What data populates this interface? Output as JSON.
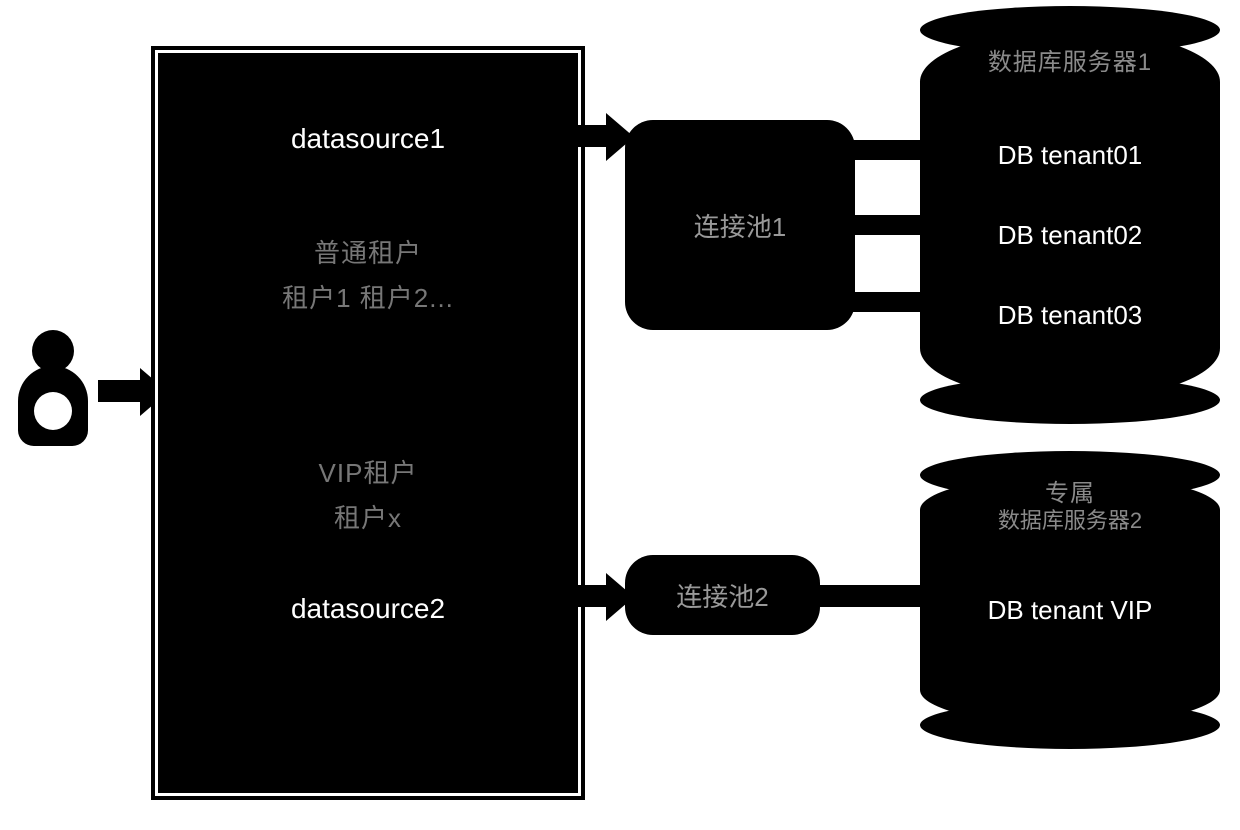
{
  "user_icon": "person-icon",
  "mainbox": {
    "datasource1_label": "datasource1",
    "users_group1_line1": "普通租户",
    "users_group1_line2": "租户1   租户2...",
    "users_group2_line1": "VIP租户",
    "users_group2_line2": "租户x",
    "datasource2_label": "datasource2"
  },
  "pools": {
    "pool1_label": "连接池1",
    "pool2_label": "连接池2"
  },
  "servers": {
    "server1": {
      "title": "数据库服务器1",
      "dbs": [
        "DB tenant01",
        "DB tenant02",
        "DB tenant03"
      ]
    },
    "server2": {
      "title_line1": "专属",
      "title_line2": "数据库服务器2",
      "dbs": [
        "DB tenant VIP"
      ]
    }
  }
}
